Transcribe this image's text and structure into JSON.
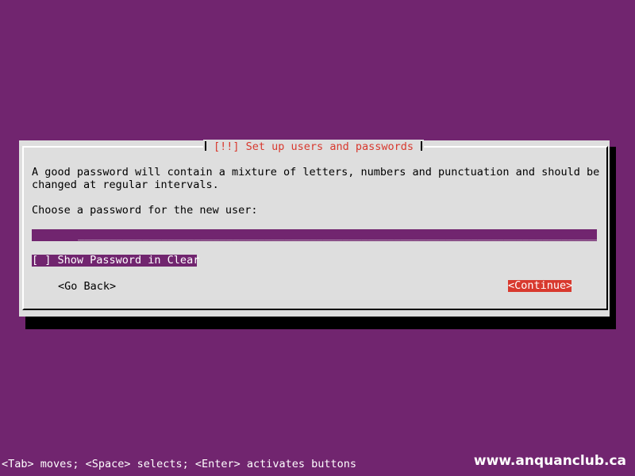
{
  "dialog": {
    "title": "[!!] Set up users and passwords",
    "description_line1": "A good password will contain a mixture of letters, numbers and punctuation and should be",
    "description_line2": "changed at regular intervals.",
    "prompt": "Choose a password for the new user:",
    "password_value": "*******",
    "password_fill": "________________________________________________________________________________________________",
    "checkbox_label": "[ ] Show Password in Clear",
    "go_back_label": "<Go Back>",
    "continue_label": "<Continue>"
  },
  "footer": {
    "help_text": "<Tab> moves; <Space> selects; <Enter> activates buttons",
    "watermark": "www.anquanclub.ca"
  },
  "colors": {
    "background": "#71256f",
    "dialog": "#dedede",
    "title": "#d8392e",
    "focus_button": "#d8392e",
    "field": "#71256f"
  }
}
